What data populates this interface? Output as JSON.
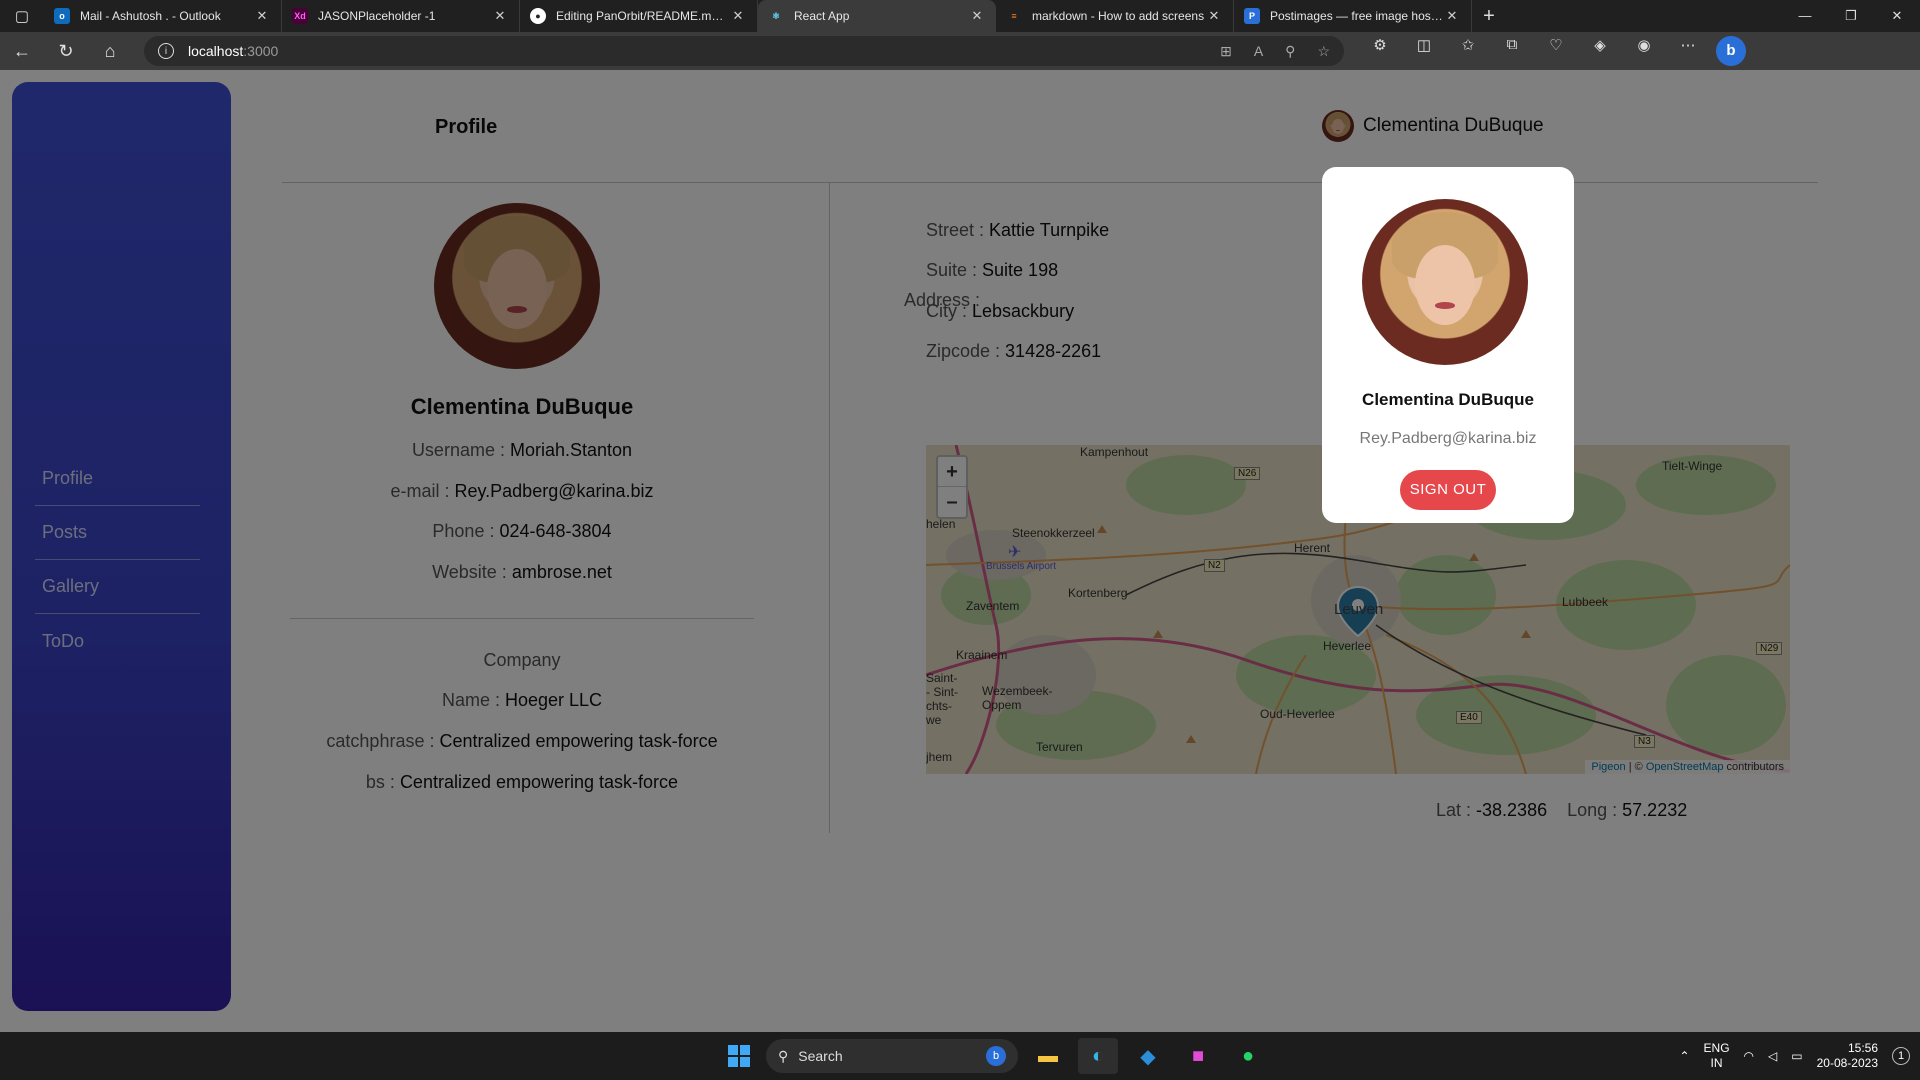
{
  "browser": {
    "tabs": [
      {
        "title": "Mail - Ashutosh . - Outlook",
        "icon": "outlook-icon",
        "color": "#0f6cbd"
      },
      {
        "title": "JASONPlaceholder -1",
        "icon": "xd-icon",
        "color": "#470137"
      },
      {
        "title": "Editing PanOrbit/README.md at",
        "icon": "github-icon",
        "color": "#222222"
      },
      {
        "title": "React App",
        "icon": "react-icon",
        "color": "#61dafb"
      },
      {
        "title": "markdown - How to add screens",
        "icon": "stackoverflow-icon",
        "color": "#f48024"
      },
      {
        "title": "Postimages — free image hostin",
        "icon": "postimages-icon",
        "color": "#2a6fd8"
      }
    ],
    "active_tab": 3,
    "url_host": "localhost",
    "url_port": ":3000"
  },
  "sidebar": {
    "items": [
      {
        "label": "Profile"
      },
      {
        "label": "Posts"
      },
      {
        "label": "Gallery"
      },
      {
        "label": "ToDo"
      }
    ]
  },
  "header": {
    "title": "Profile",
    "user_name": "Clementina DuBuque"
  },
  "profile": {
    "name": "Clementina DuBuque",
    "username_label": "Username : ",
    "username": "Moriah.Stanton",
    "email_label": "e-mail : ",
    "email": "Rey.Padberg@karina.biz",
    "phone_label": "Phone : ",
    "phone": "024-648-3804",
    "website_label": "Website : ",
    "website": "ambrose.net",
    "company_heading": "Company",
    "company_name_label": "Name : ",
    "company_name": "Hoeger LLC",
    "catchphrase_label": "catchphrase : ",
    "catchphrase": "Centralized empowering task-force",
    "bs_label": "bs : ",
    "bs": "Centralized empowering task-force"
  },
  "address": {
    "heading": "Address :",
    "street_label": "Street : ",
    "street": "Kattie Turnpike",
    "suite_label": "Suite : ",
    "suite": "Suite 198",
    "city_label": "City : ",
    "city": "Lebsackbury",
    "zipcode_label": "Zipcode : ",
    "zipcode": "31428-2261"
  },
  "map": {
    "zoom_in": "+",
    "zoom_out": "–",
    "attribution_pigeon": "Pigeon",
    "attribution_sep": " | © ",
    "attribution_osm": "OpenStreetMap",
    "attribution_tail": " contributors",
    "labels": {
      "kampenhout": "Kampenhout",
      "steenokkerzeel": "Steenokkerzeel",
      "brussels_airport": "Brussels Airport",
      "zaventem": "Zaventem",
      "kortenberg": "Kortenberg",
      "herent": "Herent",
      "leuven": "Leuven",
      "heverlee": "Heverlee",
      "kraainem": "Kraainem",
      "wezembeek": "Wezembeek-Oppem",
      "oud_heverlee": "Oud-Heverlee",
      "tervuren": "Tervuren",
      "lubbeek": "Lubbeek",
      "tielt_winge": "Tielt-Winge",
      "helen": "helen",
      "sint": "Saint-\n- Sint-\nchts-\nwe",
      "jhem": "jhem"
    },
    "roads": {
      "n26": "N26",
      "n2": "N2",
      "e40": "E40",
      "n29": "N29",
      "n3": "N3"
    }
  },
  "geo": {
    "lat_label": "Lat : ",
    "lat": "-38.2386",
    "long_label": "Long : ",
    "long": "57.2232"
  },
  "popup": {
    "name": "Clementina DuBuque",
    "email": "Rey.Padberg@karina.biz",
    "signout_label": "SIGN OUT",
    "signout_color": "#e5474b"
  },
  "taskbar": {
    "search_placeholder": "Search",
    "lang_top": "ENG",
    "lang_bottom": "IN",
    "time": "15:56",
    "date": "20-08-2023",
    "notification_count": "1"
  }
}
